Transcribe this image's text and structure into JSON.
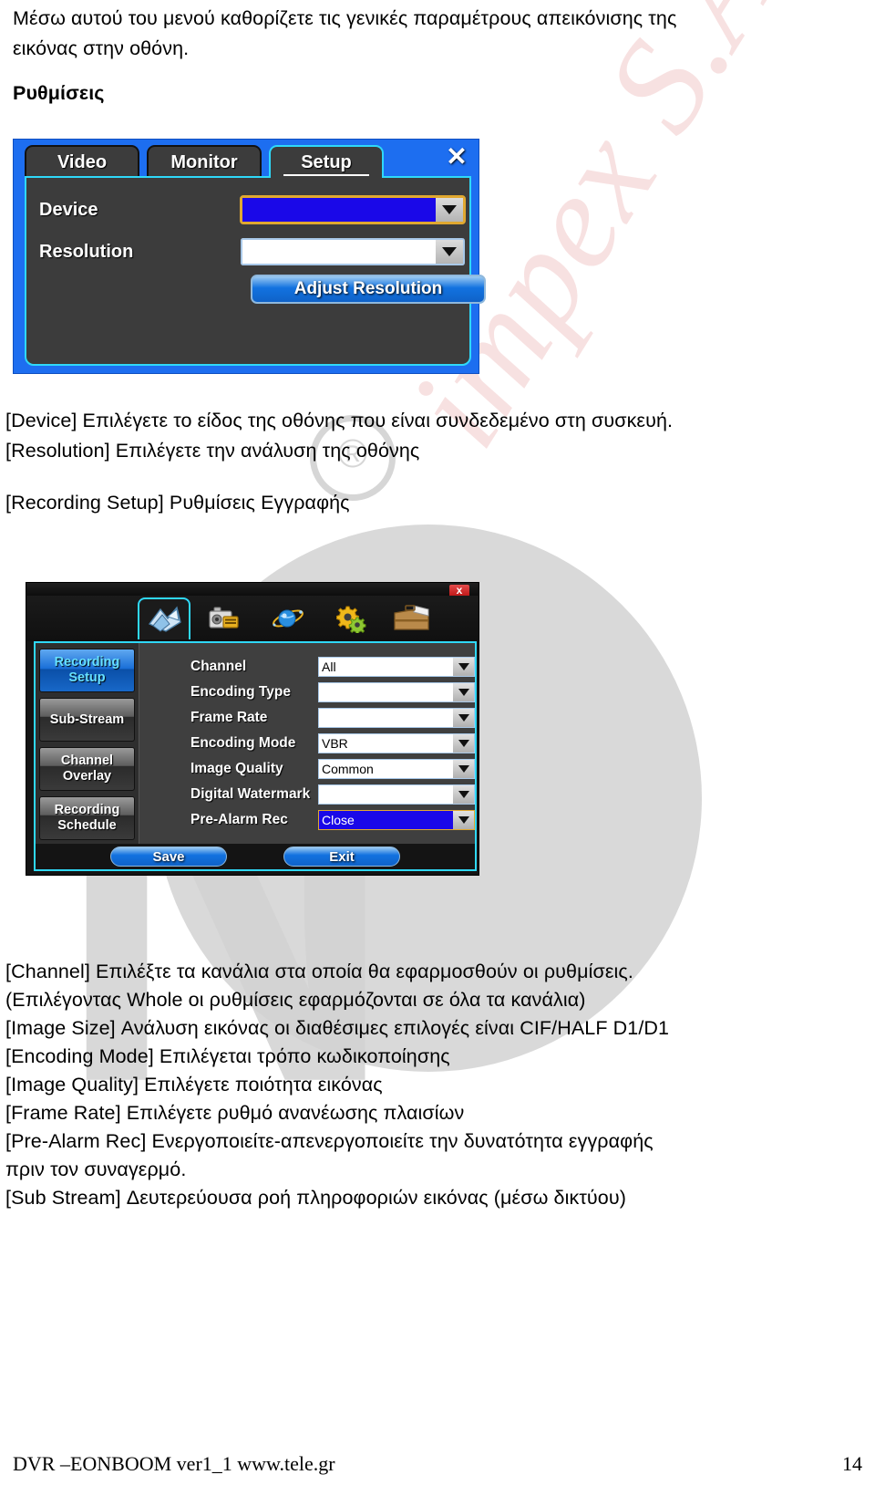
{
  "intro": {
    "line1": "Μέσω αυτού του μενού καθορίζετε τις γενικές παραμέτρους απεικόνισης της",
    "line2": "εικόνας στην οθόνη.",
    "heading": "Ρυθμίσεις"
  },
  "setup_dialog": {
    "tabs": [
      {
        "label": "Video",
        "active": false
      },
      {
        "label": "Monitor",
        "active": false
      },
      {
        "label": "Setup",
        "active": true
      }
    ],
    "close_label": "✕",
    "rows": [
      {
        "label": "Device",
        "value": "",
        "selected": true
      },
      {
        "label": "Resolution",
        "value": "",
        "selected": false
      }
    ],
    "adjust_button": "Adjust Resolution",
    "colors": {
      "frame": "#1d6ef0",
      "panel": "#3c3c3c",
      "accent": "#2fd8f8",
      "selection": "#1a08e8",
      "focus_outline": "#e0a830"
    }
  },
  "between_text": {
    "line1": "[Device] Επιλέγετε το είδος της οθόνης που είναι συνδεδεμένο στη συσκευή.",
    "line2": "[Resolution] Επιλέγετε την ανάλυση της οθόνης",
    "line3": "[Recording Setup] Ρυθμίσεις Εγγραφής"
  },
  "recording_dialog": {
    "close_label": "x",
    "toolbar_icons": [
      {
        "name": "recording-icon",
        "active": true
      },
      {
        "name": "camcorder-icon",
        "active": false
      },
      {
        "name": "network-globe-icon",
        "active": false
      },
      {
        "name": "gears-settings-icon",
        "active": false
      },
      {
        "name": "briefcase-folder-icon",
        "active": false
      }
    ],
    "sidebar": [
      {
        "label_top": "Recording",
        "label_bottom": "Setup",
        "active": true
      },
      {
        "label_top": "Sub-Stream",
        "label_bottom": "",
        "active": false
      },
      {
        "label_top": "Channel",
        "label_bottom": "Overlay",
        "active": false
      },
      {
        "label_top": "Recording",
        "label_bottom": "Schedule",
        "active": false
      }
    ],
    "fields": [
      {
        "label": "Channel",
        "value": "All",
        "selected": false
      },
      {
        "label": "Encoding Type",
        "value": "",
        "selected": false
      },
      {
        "label": "Frame Rate",
        "value": "",
        "selected": false
      },
      {
        "label": "Encoding Mode",
        "value": "VBR",
        "selected": false
      },
      {
        "label": "Image Quality",
        "value": "Common",
        "selected": false
      },
      {
        "label": "Digital Watermark",
        "value": "",
        "selected": false
      },
      {
        "label": "Pre-Alarm Rec",
        "value": "Close",
        "selected": true
      }
    ],
    "save_button": "Save",
    "exit_button": "Exit"
  },
  "description_text": {
    "line1": "[Channel] Επιλέξτε τα κανάλια στα οποία θα εφαρμοσθούν οι ρυθμίσεις.",
    "line2": "(Επιλέγοντας Whole οι ρυθμίσεις εφαρμόζονται σε όλα τα κανάλια)",
    "line3": "[Image Size] Ανάλυση εικόνας οι διαθέσιμες επιλογές είναι CIF/HALF D1/D1",
    "line4": "[Encoding Mode] Επιλέγεται τρόπο κωδικοποίησης",
    "line5": "[Image Quality] Επιλέγετε ποιότητα εικόνας",
    "line6": "[Frame Rate] Επιλέγετε ρυθμό ανανέωσης πλαισίων",
    "line7": "[Pre-Alarm Rec] Ενεργοποιείτε-απενεργοποιείτε την δυνατότητα εγγραφής",
    "line8": "πριν τον συναγερμό.",
    "line9": "[Sub Stream] Δευτερεύουσα ροή πληροφοριών εικόνας (μέσω δικτύου)"
  },
  "watermark": {
    "impex": "impex S.A.",
    "registered": "®",
    "big_letters": "N"
  },
  "footer": {
    "left": "DVR –EONBOOM ver1_1  www.tele.gr",
    "page": "14"
  }
}
